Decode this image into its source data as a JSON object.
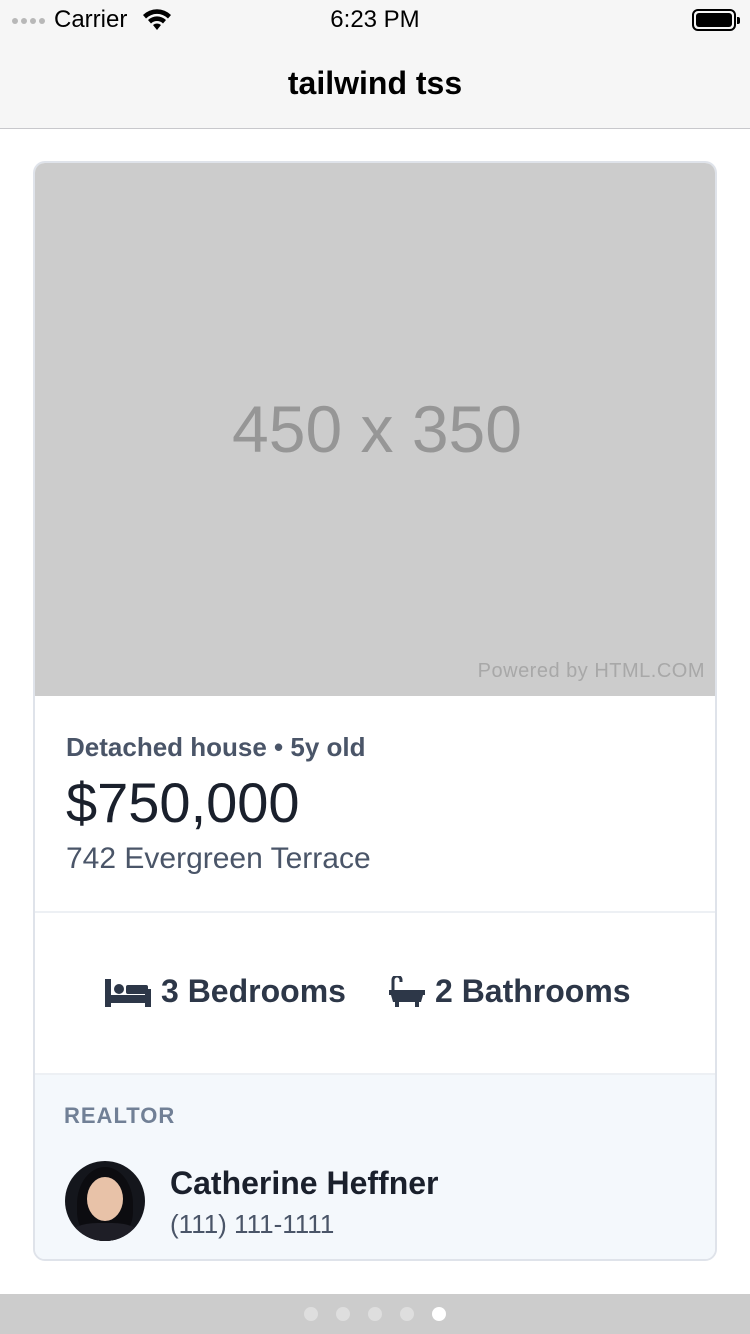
{
  "status_bar": {
    "carrier": "Carrier",
    "time": "6:23 PM"
  },
  "nav": {
    "title": "tailwind tss"
  },
  "listing": {
    "image_placeholder": "450 x 350",
    "image_credit": "Powered by HTML.COM",
    "subtitle": "Detached house • 5y old",
    "price": "$750,000",
    "address": "742 Evergreen Terrace",
    "bedrooms": "3 Bedrooms",
    "bathrooms": "2 Bathrooms",
    "bed_icon": "bed-icon",
    "bath_icon": "bathtub-icon"
  },
  "realtor": {
    "heading": "REALTOR",
    "name": "Catherine Heffner",
    "phone": "(111) 111-1111"
  },
  "pager": {
    "count": 5,
    "active_index": 4
  },
  "colors": {
    "text_dark": "#1a202c",
    "text_muted": "#4a5568",
    "realtor_bg": "#f4f8fc",
    "placeholder_bg": "#cccccc"
  }
}
